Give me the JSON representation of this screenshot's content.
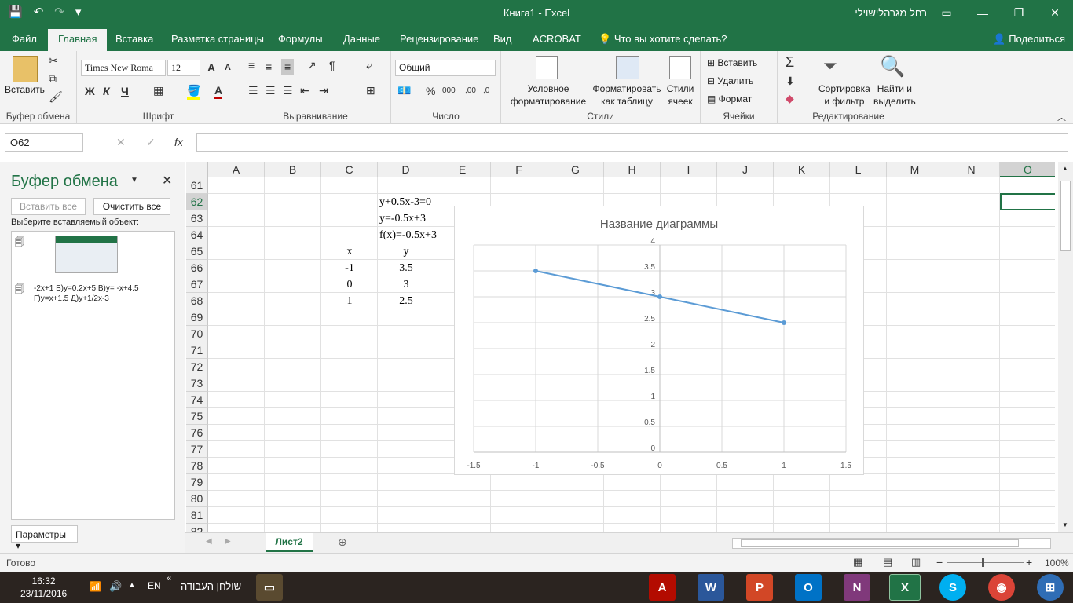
{
  "title_bar": {
    "doc_title": "Книга1 - Excel",
    "user": "רחל מגרהלישוילי",
    "qa_save": "💾",
    "qa_undo": "↶",
    "qa_redo": "↷",
    "qa_more": "▾",
    "win_ribbon": "▭",
    "win_min": "—",
    "win_max": "❐",
    "win_close": "✕"
  },
  "tabs": [
    "Файл",
    "Главная",
    "Вставка",
    "Разметка страницы",
    "Формулы",
    "Данные",
    "Рецензирование",
    "Вид",
    "ACROBAT",
    "Что вы хотите сделать?"
  ],
  "share": "Поделиться",
  "ribbon": {
    "clipboard": {
      "paste": "Вставить",
      "label": "Буфер обмена"
    },
    "font": {
      "name": "Times New Roma",
      "size": "12",
      "bold": "Ж",
      "italic": "К",
      "underline": "Ч",
      "grow": "A",
      "shrink": "A",
      "label": "Шрифт"
    },
    "align": {
      "label": "Выравнивание"
    },
    "number": {
      "format": "Общий",
      "percent": "%",
      "thousands": "000",
      "dec_inc": ",00",
      "dec_dec": ",0",
      "label": "Число"
    },
    "styles": {
      "cond1": "Условное",
      "cond2": "форматирование",
      "table1": "Форматировать",
      "table2": "как таблицу",
      "cell1": "Стили",
      "cell2": "ячеек",
      "label": "Стили"
    },
    "cells": {
      "insert": "Вставить",
      "delete": "Удалить",
      "format": "Формат",
      "label": "Ячейки"
    },
    "editing": {
      "sigma": "Σ",
      "sort1": "Сортировка",
      "sort2": "и фильтр",
      "find1": "Найти и",
      "find2": "выделить",
      "label": "Редактирование"
    }
  },
  "formula_bar": {
    "name_box": "O62",
    "cancel": "✕",
    "enter": "✓",
    "fx": "fx",
    "formula": ""
  },
  "clipboard_pane": {
    "title": "Буфер обмена",
    "paste_all": "Вставить все",
    "clear_all": "Очистить все",
    "prompt": "Выберите вставляемый объект:",
    "item2_line1": "-2x+1 Б)y=0.2x+5 В)y= -x+4.5",
    "item2_line2": "Г)y=x+1.5 Д)y+1/2x-3",
    "options": "Параметры"
  },
  "columns": [
    "A",
    "B",
    "C",
    "D",
    "E",
    "F",
    "G",
    "H",
    "I",
    "J",
    "K",
    "L",
    "M",
    "N",
    "O"
  ],
  "rows": [
    "61",
    "62",
    "63",
    "64",
    "65",
    "66",
    "67",
    "68",
    "69",
    "70",
    "71",
    "72",
    "73",
    "74",
    "75",
    "76",
    "77",
    "78",
    "79",
    "80",
    "81",
    "82"
  ],
  "cells": {
    "d62": "y+0.5x-3=0",
    "d63": "y=-0.5x+3",
    "d64": "f(x)=-0.5x+3",
    "c65": "x",
    "d65": "y",
    "c66": "-1",
    "d66": "3.5",
    "c67": "0",
    "d67": "3",
    "c68": "1",
    "d68": "2.5"
  },
  "chart_data": {
    "type": "scatter",
    "title": "Название диаграммы",
    "x": [
      -1,
      0,
      1
    ],
    "y": [
      3.5,
      3,
      2.5
    ],
    "xlim": [
      -1.5,
      1.5
    ],
    "ylim": [
      0,
      4
    ],
    "x_ticks": [
      "-1.5",
      "-1",
      "-0.5",
      "0",
      "0.5",
      "1",
      "1.5"
    ],
    "y_ticks": [
      "0",
      "0.5",
      "1",
      "1.5",
      "2",
      "2.5",
      "3",
      "3.5",
      "4"
    ],
    "color": "#5b9bd5",
    "grid": true
  },
  "sheet_tab": "Лист2",
  "status": {
    "ready": "Готово",
    "zoom": "100%"
  },
  "taskbar": {
    "time": "16:32",
    "date": "23/11/2016",
    "lang": "EN",
    "desktop": "שולחן העבודה"
  }
}
